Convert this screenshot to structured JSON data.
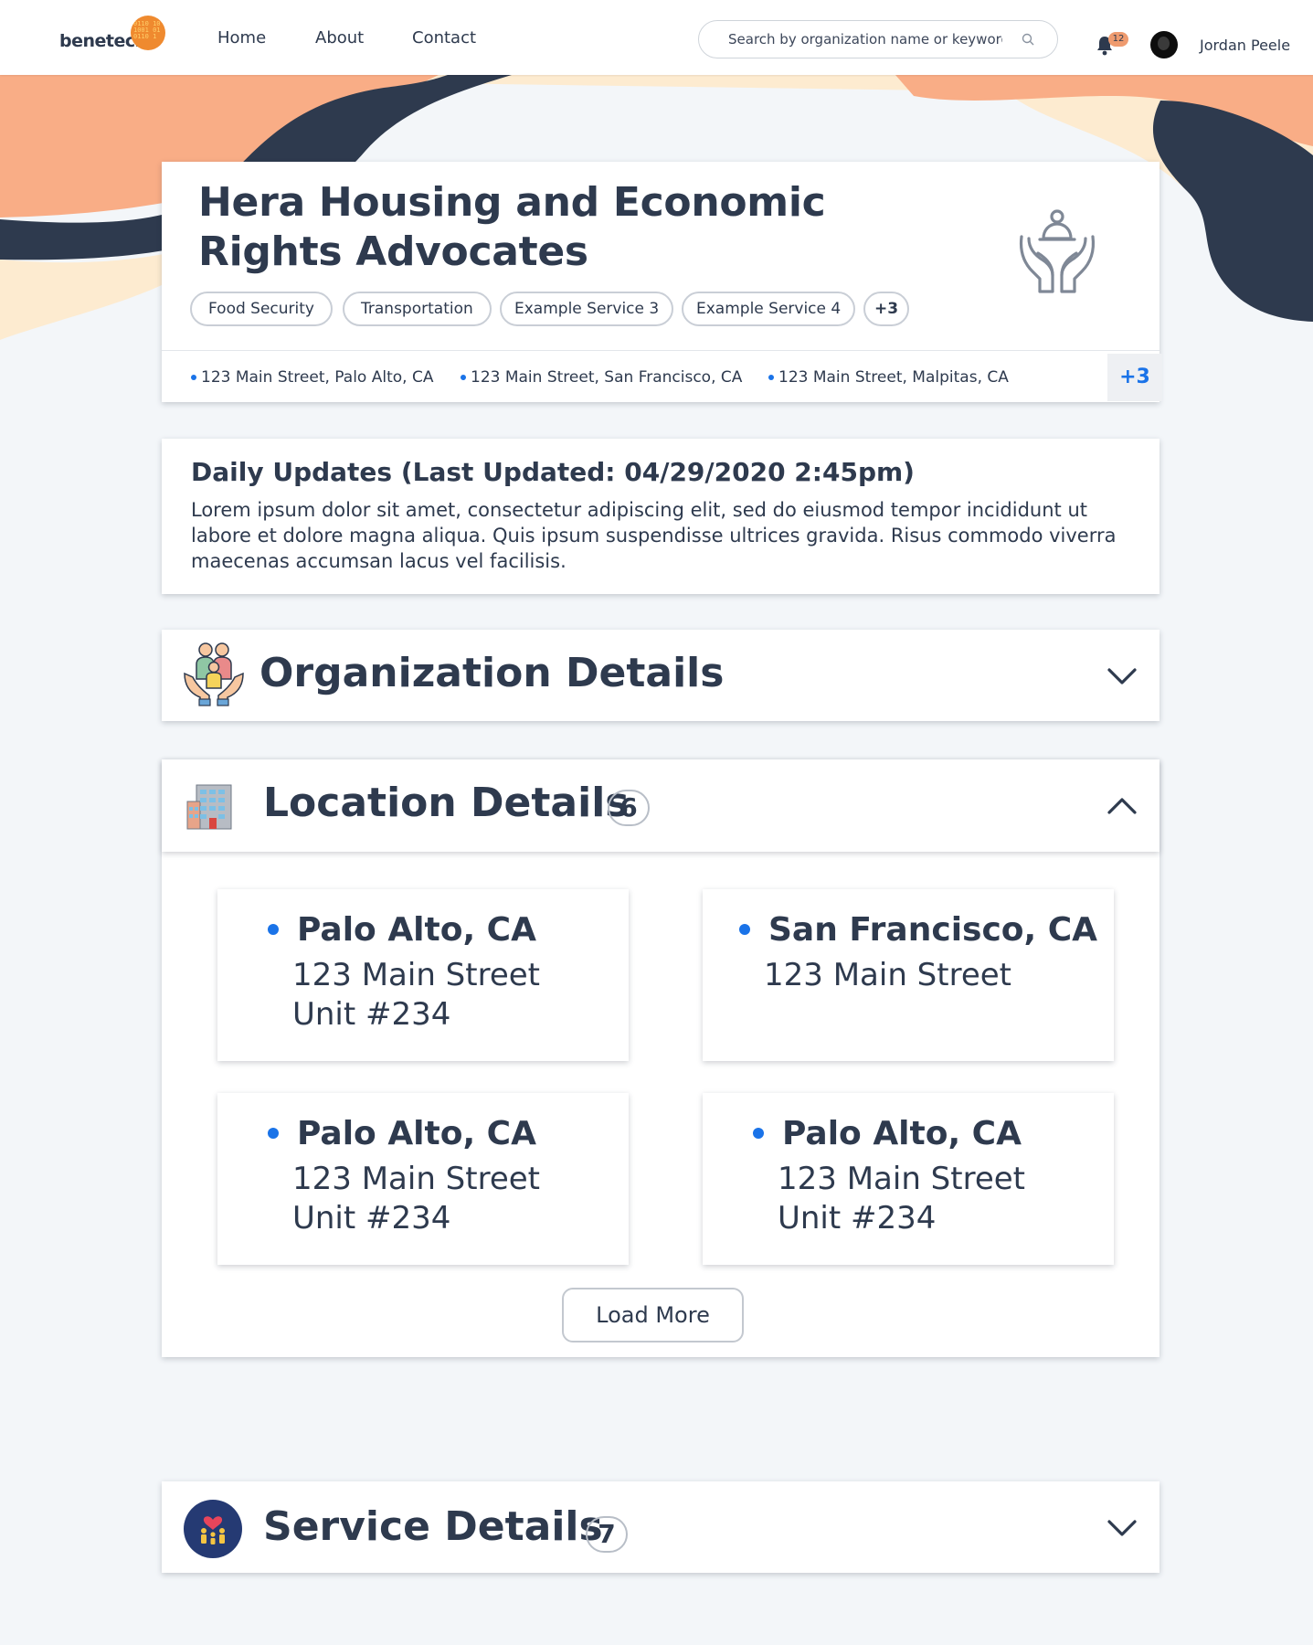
{
  "header": {
    "logo_text": "benetech",
    "nav": [
      "Home",
      "About",
      "Contact"
    ],
    "search_placeholder": "Search by organization name or keyword",
    "notification_count": "12",
    "user_name": "Jordan Peele"
  },
  "organization": {
    "name": "Hera Housing and Economic Rights Advocates",
    "tags": [
      "Food Security",
      "Transportation",
      "Example Service 3",
      "Example Service 4",
      "+3"
    ],
    "addresses": [
      "123 Main Street, Palo Alto, CA",
      "123 Main Street, San Francisco, CA",
      "123 Main Street, Malpitas, CA"
    ],
    "addresses_more": "+3"
  },
  "updates": {
    "title": "Daily Updates (Last Updated: 04/29/2020 2:45pm)",
    "body": "Lorem ipsum dolor sit amet, consectetur adipiscing elit, sed do eiusmod tempor incididunt ut labore et dolore magna aliqua. Quis ipsum suspendisse ultrices gravida. Risus commodo viverra maecenas accumsan lacus vel facilisis."
  },
  "sections": {
    "organization_details": {
      "title": "Organization Details"
    },
    "location_details": {
      "title": "Location Details",
      "count": "6"
    },
    "service_details": {
      "title": "Service Details",
      "count": "7"
    }
  },
  "locations": [
    {
      "city": "Palo Alto, CA",
      "street": "123 Main Street",
      "unit": "Unit #234"
    },
    {
      "city": "San Francisco, CA",
      "street": "123 Main Street",
      "unit": ""
    },
    {
      "city": "Palo Alto, CA",
      "street": "123 Main Street",
      "unit": "Unit #234"
    },
    {
      "city": "Palo Alto, CA",
      "street": "123 Main Street",
      "unit": "Unit #234"
    }
  ],
  "load_more_label": "Load More",
  "colors": {
    "accent_blue": "#1a73e8",
    "navy": "#2e3a4e",
    "peach": "#f9ad86",
    "cream": "#fdebd0",
    "badge_orange": "#ef9b6f"
  }
}
